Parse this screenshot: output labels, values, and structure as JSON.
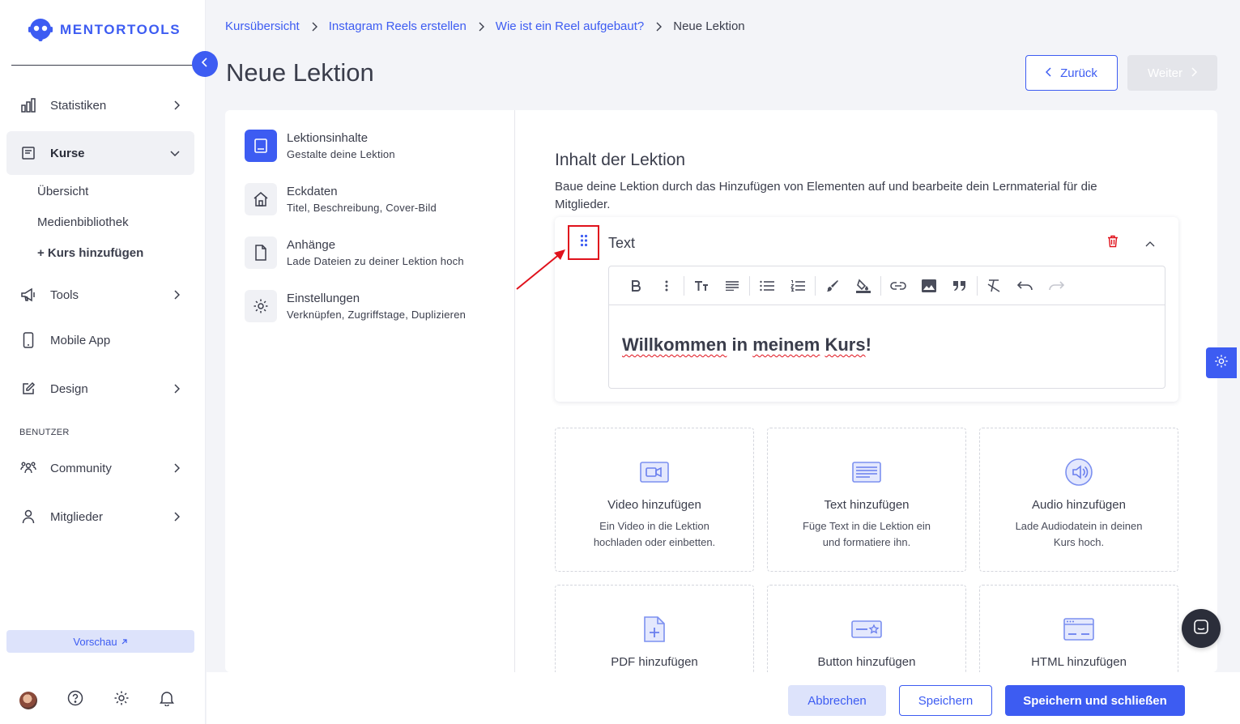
{
  "brand": {
    "name": "MENTORTOOLS",
    "color": "#3d5cf2"
  },
  "sidebar": {
    "items": [
      {
        "label": "Statistiken",
        "icon": "bar-chart-icon"
      },
      {
        "label": "Kurse",
        "icon": "book-icon"
      },
      {
        "label": "Tools",
        "icon": "megaphone-icon"
      },
      {
        "label": "Mobile App",
        "icon": "phone-icon"
      },
      {
        "label": "Design",
        "icon": "pencil-icon"
      },
      {
        "label": "Community",
        "icon": "people-icon"
      },
      {
        "label": "Mitglieder",
        "icon": "person-icon"
      }
    ],
    "sub_items": [
      "Übersicht",
      "Medienbibliothek",
      "+ Kurs hinzufügen"
    ],
    "section_label": "BENUTZER",
    "preview_label": "Vorschau"
  },
  "breadcrumb": [
    "Kursübersicht",
    "Instagram Reels erstellen",
    "Wie ist ein Reel aufgebaut?",
    "Neue Lektion"
  ],
  "page_title": "Neue Lektion",
  "nav_buttons": {
    "back": "Zurück",
    "next": "Weiter"
  },
  "steps": [
    {
      "title": "Lektionsinhalte",
      "subtitle": "Gestalte deine Lektion",
      "icon": "book-icon"
    },
    {
      "title": "Eckdaten",
      "subtitle": "Titel, Beschreibung, Cover-Bild",
      "icon": "home-icon"
    },
    {
      "title": "Anhänge",
      "subtitle": "Lade Dateien zu deiner Lektion hoch",
      "icon": "file-icon"
    },
    {
      "title": "Einstellungen",
      "subtitle": "Verknüpfen, Zugriffstage, Duplizieren",
      "icon": "gear-icon"
    }
  ],
  "content": {
    "title": "Inhalt der Lektion",
    "description": "Baue deine Lektion durch das Hinzufügen von Elementen auf und bearbeite dein Lernmaterial für die Mitglieder."
  },
  "text_block": {
    "title": "Text",
    "editor_words": [
      "Willkommen",
      "in",
      "meinem",
      "Kurs"
    ],
    "editor_suffix": "!"
  },
  "tiles": [
    {
      "title": "Video hinzufügen",
      "desc": "Ein Video in die Lektion hochladen oder einbetten.",
      "icon": "video-icon"
    },
    {
      "title": "Text hinzufügen",
      "desc": "Füge Text in die Lektion ein und formatiere ihn.",
      "icon": "text-icon"
    },
    {
      "title": "Audio hinzufügen",
      "desc": "Lade Audiodatein in deinen Kurs hoch.",
      "icon": "audio-icon"
    },
    {
      "title": "PDF hinzufügen",
      "desc": "",
      "icon": "pdf-icon"
    },
    {
      "title": "Button hinzufügen",
      "desc": "",
      "icon": "button-icon"
    },
    {
      "title": "HTML hinzufügen",
      "desc": "",
      "icon": "html-icon"
    }
  ],
  "footer": {
    "cancel": "Abbrechen",
    "save": "Speichern",
    "save_close": "Speichern und schließen"
  }
}
